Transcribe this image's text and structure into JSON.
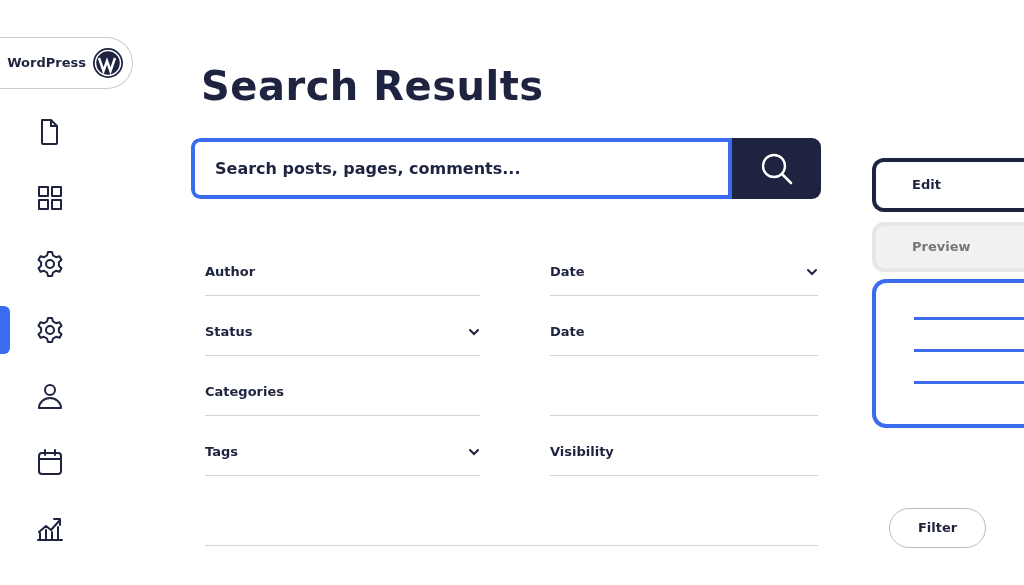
{
  "brand": {
    "label": "WordPress"
  },
  "nav": [
    {
      "kind": "file",
      "selected": false
    },
    {
      "kind": "grid",
      "selected": false
    },
    {
      "kind": "gear",
      "selected": false
    },
    {
      "kind": "gear",
      "selected": true
    },
    {
      "kind": "user",
      "selected": false
    },
    {
      "kind": "calendar",
      "selected": false
    },
    {
      "kind": "chart",
      "selected": false
    }
  ],
  "title": "Search Results",
  "search": {
    "placeholder": "Search posts, pages, comments..."
  },
  "filters": [
    {
      "kind": "text",
      "label": "Author"
    },
    {
      "kind": "select",
      "label": "Date"
    },
    {
      "kind": "select",
      "label": "Status"
    },
    {
      "kind": "text",
      "label": "Date"
    },
    {
      "kind": "text",
      "label": "Categories"
    },
    {
      "kind": "blank"
    },
    {
      "kind": "select",
      "label": "Tags"
    },
    {
      "kind": "text",
      "label": "Visibility"
    }
  ],
  "tabs": [
    {
      "label": "Edit",
      "selected": true
    },
    {
      "label": "Preview",
      "selected": false
    }
  ],
  "filter_button": "Filter"
}
